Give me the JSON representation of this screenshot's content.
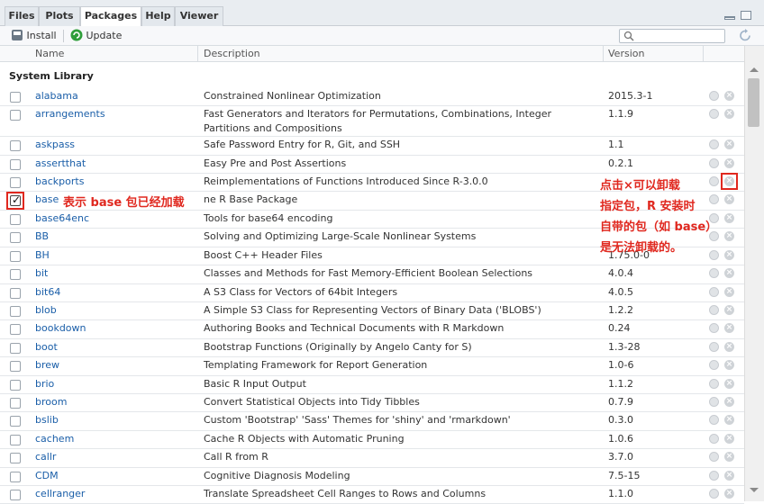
{
  "tabs": [
    "Files",
    "Plots",
    "Packages",
    "Help",
    "Viewer"
  ],
  "active_tab": "Packages",
  "toolbar": {
    "install_label": "Install",
    "update_label": "Update",
    "search_placeholder": ""
  },
  "columns": {
    "name": "Name",
    "description": "Description",
    "version": "Version"
  },
  "section_title": "System Library",
  "packages": [
    {
      "name": "alabama",
      "description": "Constrained Nonlinear Optimization",
      "version": "2015.3-1",
      "checked": false
    },
    {
      "name": "arrangements",
      "description": "Fast Generators and Iterators for Permutations, Combinations, Integer Partitions and Compositions",
      "version": "1.1.9",
      "checked": false
    },
    {
      "name": "askpass",
      "description": "Safe Password Entry for R, Git, and SSH",
      "version": "1.1",
      "checked": false
    },
    {
      "name": "assertthat",
      "description": "Easy Pre and Post Assertions",
      "version": "0.2.1",
      "checked": false
    },
    {
      "name": "backports",
      "description": "Reimplementations of Functions Introduced Since R-3.0.0",
      "version": "",
      "checked": false
    },
    {
      "name": "base",
      "description": "ne R Base Package",
      "version": "",
      "checked": true
    },
    {
      "name": "base64enc",
      "description": "Tools for base64 encoding",
      "version": "",
      "checked": false
    },
    {
      "name": "BB",
      "description": "Solving and Optimizing Large-Scale Nonlinear Systems",
      "version": "",
      "checked": false
    },
    {
      "name": "BH",
      "description": "Boost C++ Header Files",
      "version": "1.75.0-0",
      "checked": false
    },
    {
      "name": "bit",
      "description": "Classes and Methods for Fast Memory-Efficient Boolean Selections",
      "version": "4.0.4",
      "checked": false
    },
    {
      "name": "bit64",
      "description": "A S3 Class for Vectors of 64bit Integers",
      "version": "4.0.5",
      "checked": false
    },
    {
      "name": "blob",
      "description": "A Simple S3 Class for Representing Vectors of Binary Data ('BLOBS')",
      "version": "1.2.2",
      "checked": false
    },
    {
      "name": "bookdown",
      "description": "Authoring Books and Technical Documents with R Markdown",
      "version": "0.24",
      "checked": false
    },
    {
      "name": "boot",
      "description": "Bootstrap Functions (Originally by Angelo Canty for S)",
      "version": "1.3-28",
      "checked": false
    },
    {
      "name": "brew",
      "description": "Templating Framework for Report Generation",
      "version": "1.0-6",
      "checked": false
    },
    {
      "name": "brio",
      "description": "Basic R Input Output",
      "version": "1.1.2",
      "checked": false
    },
    {
      "name": "broom",
      "description": "Convert Statistical Objects into Tidy Tibbles",
      "version": "0.7.9",
      "checked": false
    },
    {
      "name": "bslib",
      "description": "Custom 'Bootstrap' 'Sass' Themes for 'shiny' and 'rmarkdown'",
      "version": "0.3.0",
      "checked": false
    },
    {
      "name": "cachem",
      "description": "Cache R Objects with Automatic Pruning",
      "version": "1.0.6",
      "checked": false
    },
    {
      "name": "callr",
      "description": "Call R from R",
      "version": "3.7.0",
      "checked": false
    },
    {
      "name": "CDM",
      "description": "Cognitive Diagnosis Modeling",
      "version": "7.5-15",
      "checked": false
    },
    {
      "name": "cellranger",
      "description": "Translate Spreadsheet Cell Ranges to Rows and Columns",
      "version": "1.1.0",
      "checked": false
    }
  ],
  "annotations": {
    "base_note": "表示 base 包已经加载",
    "uninstall_note": [
      "点击×可以卸载",
      "指定包，R 安装时",
      "自带的包（如 base）",
      "是无法卸载的。"
    ]
  },
  "colors": {
    "annotation": "#e0281f",
    "link": "#1a5ea8"
  },
  "icons": {
    "install": "install-icon",
    "update": "update-icon",
    "search": "search-icon",
    "refresh": "refresh-icon",
    "website": "globe-icon",
    "remove": "remove-icon"
  }
}
